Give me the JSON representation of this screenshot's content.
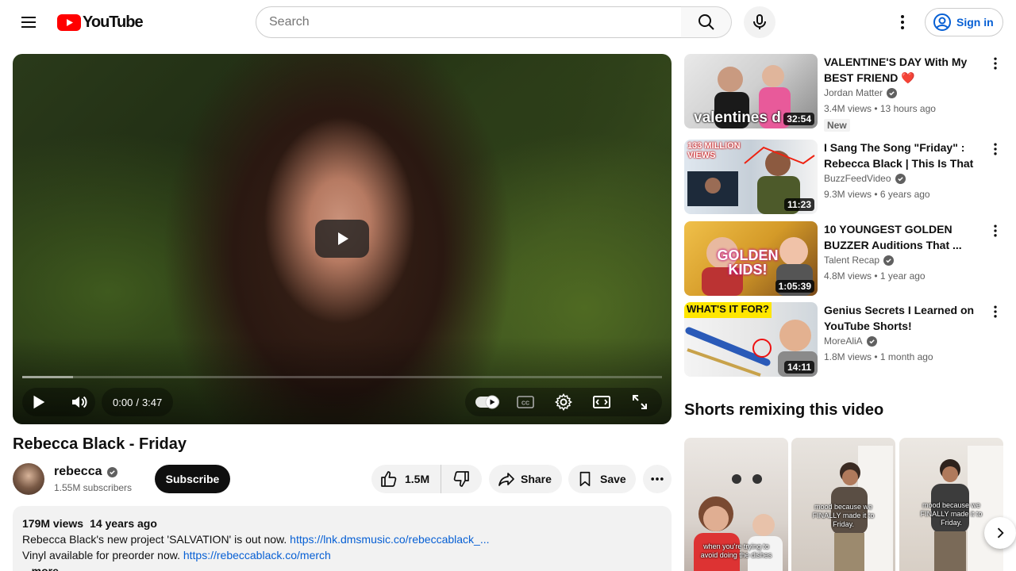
{
  "header": {
    "logo_text": "YouTube",
    "search_placeholder": "Search",
    "sign_in_label": "Sign in"
  },
  "player": {
    "current_time": "0:00",
    "time_separator": "/",
    "duration": "3:47",
    "loaded_fraction": 0.08,
    "icons": [
      "play-icon",
      "volume-icon",
      "autoplay-toggle-icon",
      "captions-icon",
      "settings-icon",
      "theater-icon",
      "fullscreen-icon"
    ]
  },
  "video": {
    "title": "Rebecca Black - Friday",
    "channel_name": "rebecca",
    "subscribers": "1.55M subscribers",
    "subscribe_label": "Subscribe",
    "likes": "1.5M",
    "share_label": "Share",
    "save_label": "Save"
  },
  "description": {
    "views": "179M views",
    "age": "14 years ago",
    "line1_text": "Rebecca Black's new project 'SALVATION' is out now.",
    "line1_link": "https://lnk.dmsmusic.co/rebeccablack_...",
    "line2_text": "Vinyl available for preorder now.",
    "line2_link": "https://rebeccablack.co/merch",
    "more_label": "...more"
  },
  "recommendations": [
    {
      "title": "VALENTINE'S DAY With My BEST FRIEND ❤️",
      "channel": "Jordan Matter",
      "meta": "3.4M views • 13 hours ago",
      "badge": "New",
      "duration": "32:54",
      "thumb_text": "valentines d"
    },
    {
      "title": "I Sang The Song \"Friday\" : Rebecca Black | This Is That ...",
      "channel": "BuzzFeedVideo",
      "meta": "9.3M views • 6 years ago",
      "duration": "11:23",
      "thumb_text": "133 MILLION VIEWS"
    },
    {
      "title": "10 YOUNGEST GOLDEN BUZZER Auditions That ...",
      "channel": "Talent Recap",
      "meta": "4.8M views • 1 year ago",
      "duration": "1:05:39",
      "thumb_text": "GOLDEN KIDS!"
    },
    {
      "title": "Genius Secrets I Learned on YouTube Shorts!",
      "channel": "MoreAliA",
      "meta": "1.8M views • 1 month ago",
      "duration": "14:11",
      "thumb_text": "WHAT'S IT FOR?"
    }
  ],
  "shorts": {
    "title": "Shorts remixing this video",
    "items": [
      {
        "caption": "when you're trying to avoid doing the dishes"
      },
      {
        "caption": "mood because we FINALLY made it to Friday."
      },
      {
        "caption": "mood because we FINALLY made it to Friday."
      }
    ]
  },
  "colors": {
    "brand_red": "#ff0000",
    "link_blue": "#065fd4",
    "text_secondary": "#606060",
    "chip_bg": "#f2f2f2"
  }
}
